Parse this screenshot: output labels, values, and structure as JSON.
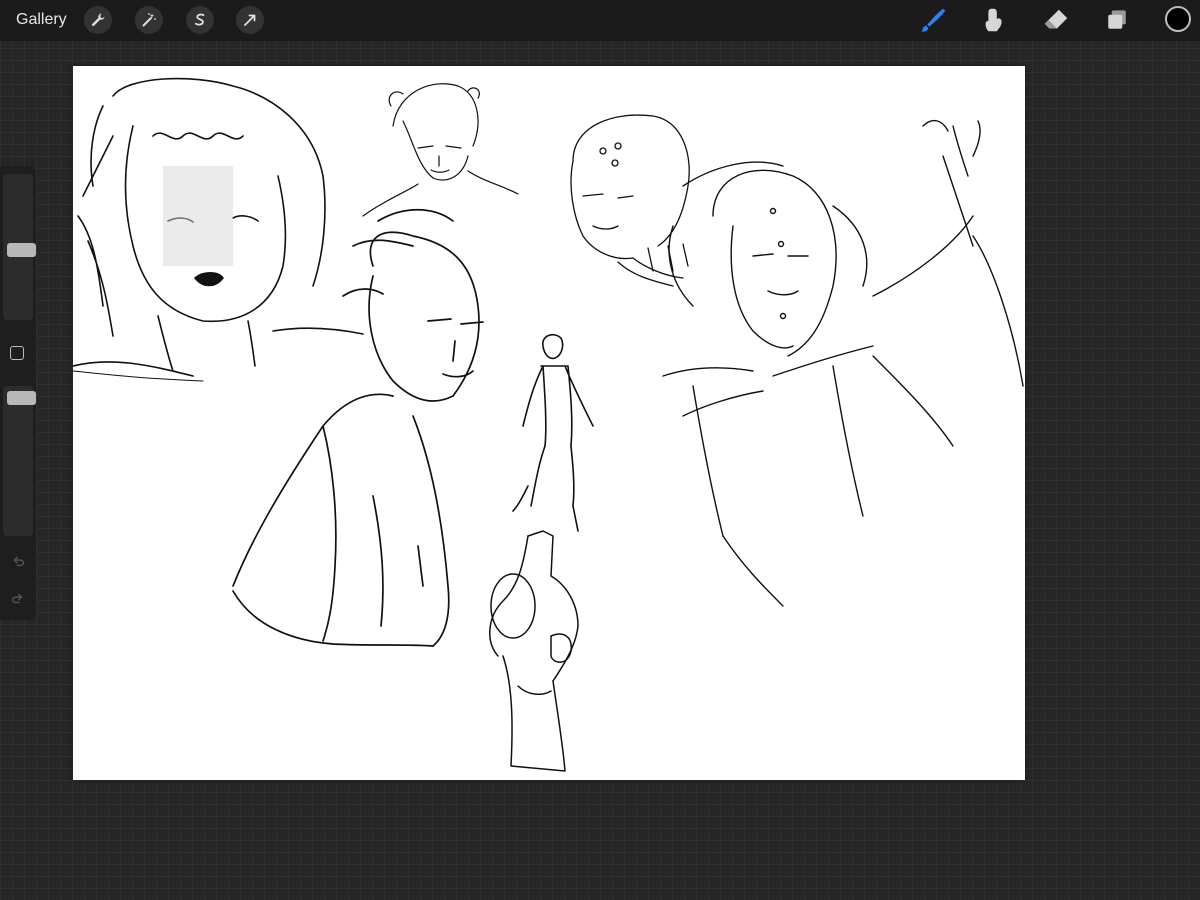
{
  "topbar": {
    "gallery_label": "Gallery",
    "left_tools": [
      {
        "name": "actions",
        "icon": "wrench-icon"
      },
      {
        "name": "adjustments",
        "icon": "magic-wand-icon"
      },
      {
        "name": "selection",
        "icon": "s-selection-icon"
      },
      {
        "name": "transform",
        "icon": "arrow-cursor-icon"
      }
    ],
    "right_tools": [
      {
        "name": "brush",
        "icon": "brush-icon",
        "active": true
      },
      {
        "name": "smudge",
        "icon": "smudge-icon",
        "active": false
      },
      {
        "name": "eraser",
        "icon": "eraser-icon",
        "active": false
      },
      {
        "name": "layers",
        "icon": "layers-icon",
        "active": false
      }
    ],
    "current_color": "#000000",
    "accent_color": "#2f7ff5"
  },
  "sidebar": {
    "brush_size_level": 0.48,
    "opacity_level": 0.0,
    "modify_button": "square-icon",
    "undo_icon": "undo-icon",
    "redo_icon": "redo-icon"
  },
  "canvas": {
    "background": "#ffffff",
    "content": "sketch-drawings"
  }
}
